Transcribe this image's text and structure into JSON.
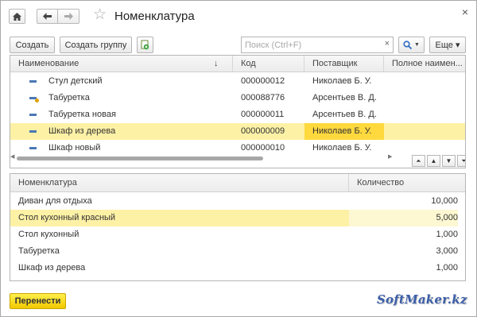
{
  "window": {
    "title": "Номенклатура",
    "close_symbol": "×"
  },
  "toolbar": {
    "create_label": "Создать",
    "create_group_label": "Создать группу",
    "search_placeholder": "Поиск (Ctrl+F)",
    "search_clear": "×",
    "more_label": "Еще ▾"
  },
  "upper_table": {
    "columns": [
      "Наименование",
      "Код",
      "Поставщик",
      "Полное наимен..."
    ],
    "sort_indicator": "↓",
    "rows": [
      {
        "name": "Стул детский",
        "code": "000000012",
        "supplier": "Николаев Б. У.",
        "icon": "item-icon"
      },
      {
        "name": "Табуретка",
        "code": "000088776",
        "supplier": "Арсентьев В. Д.",
        "icon": "item-icon-marked"
      },
      {
        "name": "Табуретка новая",
        "code": "000000011",
        "supplier": "Арсентьев В. Д.",
        "icon": "item-icon"
      },
      {
        "name": "Шкаф из дерева",
        "code": "000000009",
        "supplier": "Николаев Б. У.",
        "icon": "item-icon",
        "selected": true
      },
      {
        "name": "Шкаф новый",
        "code": "000000010",
        "supplier": "Николаев Б. У.",
        "icon": "item-icon"
      }
    ]
  },
  "lower_table": {
    "columns": [
      "Номенклатура",
      "Количество"
    ],
    "rows": [
      {
        "name": "Диван для отдыха",
        "qty": "10,000"
      },
      {
        "name": "Стол кухонный красный",
        "qty": "5,000",
        "selected": true
      },
      {
        "name": "Стол кухонный",
        "qty": "1,000"
      },
      {
        "name": "Табуретка",
        "qty": "3,000"
      },
      {
        "name": "Шкаф из дерева",
        "qty": "1,000"
      }
    ]
  },
  "footer": {
    "transfer_label": "Перенести",
    "watermark": "SoftMaker.kz"
  },
  "colors": {
    "selection": "#fdf1a6",
    "supplier_highlight": "#ffd93e",
    "primary_button": "#f2c800",
    "item_icon": "#4a78b5"
  }
}
